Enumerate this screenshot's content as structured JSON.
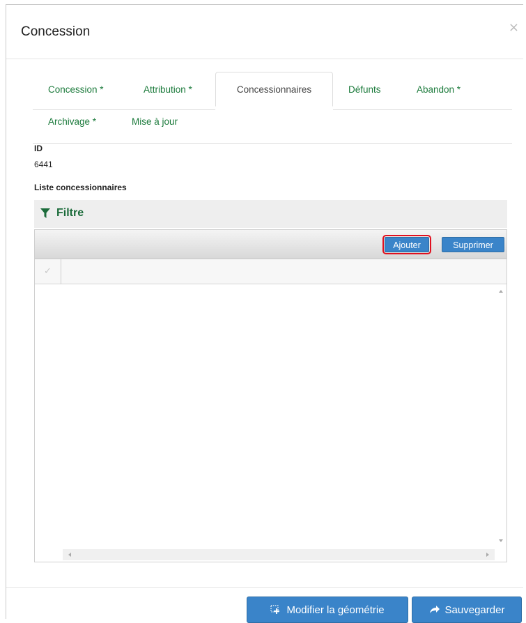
{
  "modal": {
    "title": "Concession",
    "close_symbol": "×"
  },
  "tabs": [
    {
      "label": "Concession *",
      "active": false
    },
    {
      "label": "Attribution *",
      "active": false
    },
    {
      "label": "Concessionnaires",
      "active": true
    },
    {
      "label": "Défunts",
      "active": false
    },
    {
      "label": "Abandon *",
      "active": false
    },
    {
      "label": "Archivage *",
      "active": false
    },
    {
      "label": "Mise à jour",
      "active": false
    }
  ],
  "fields": {
    "id_label": "ID",
    "id_value": "6441",
    "list_label": "Liste concessionnaires"
  },
  "filter": {
    "label": "Filtre",
    "icon": "filter-icon"
  },
  "grid": {
    "add_label": "Ajouter",
    "delete_label": "Supprimer",
    "check_symbol": "✓"
  },
  "footer": {
    "geometry_label": "Modifier la géométrie",
    "geometry_icon": "geometry-edit-icon",
    "save_label": "Sauvegarder",
    "save_icon": "arrow-right-icon"
  },
  "colors": {
    "accent": "#3a84c9",
    "tab_text": "#1b7a3b",
    "highlight": "#e0101f"
  }
}
